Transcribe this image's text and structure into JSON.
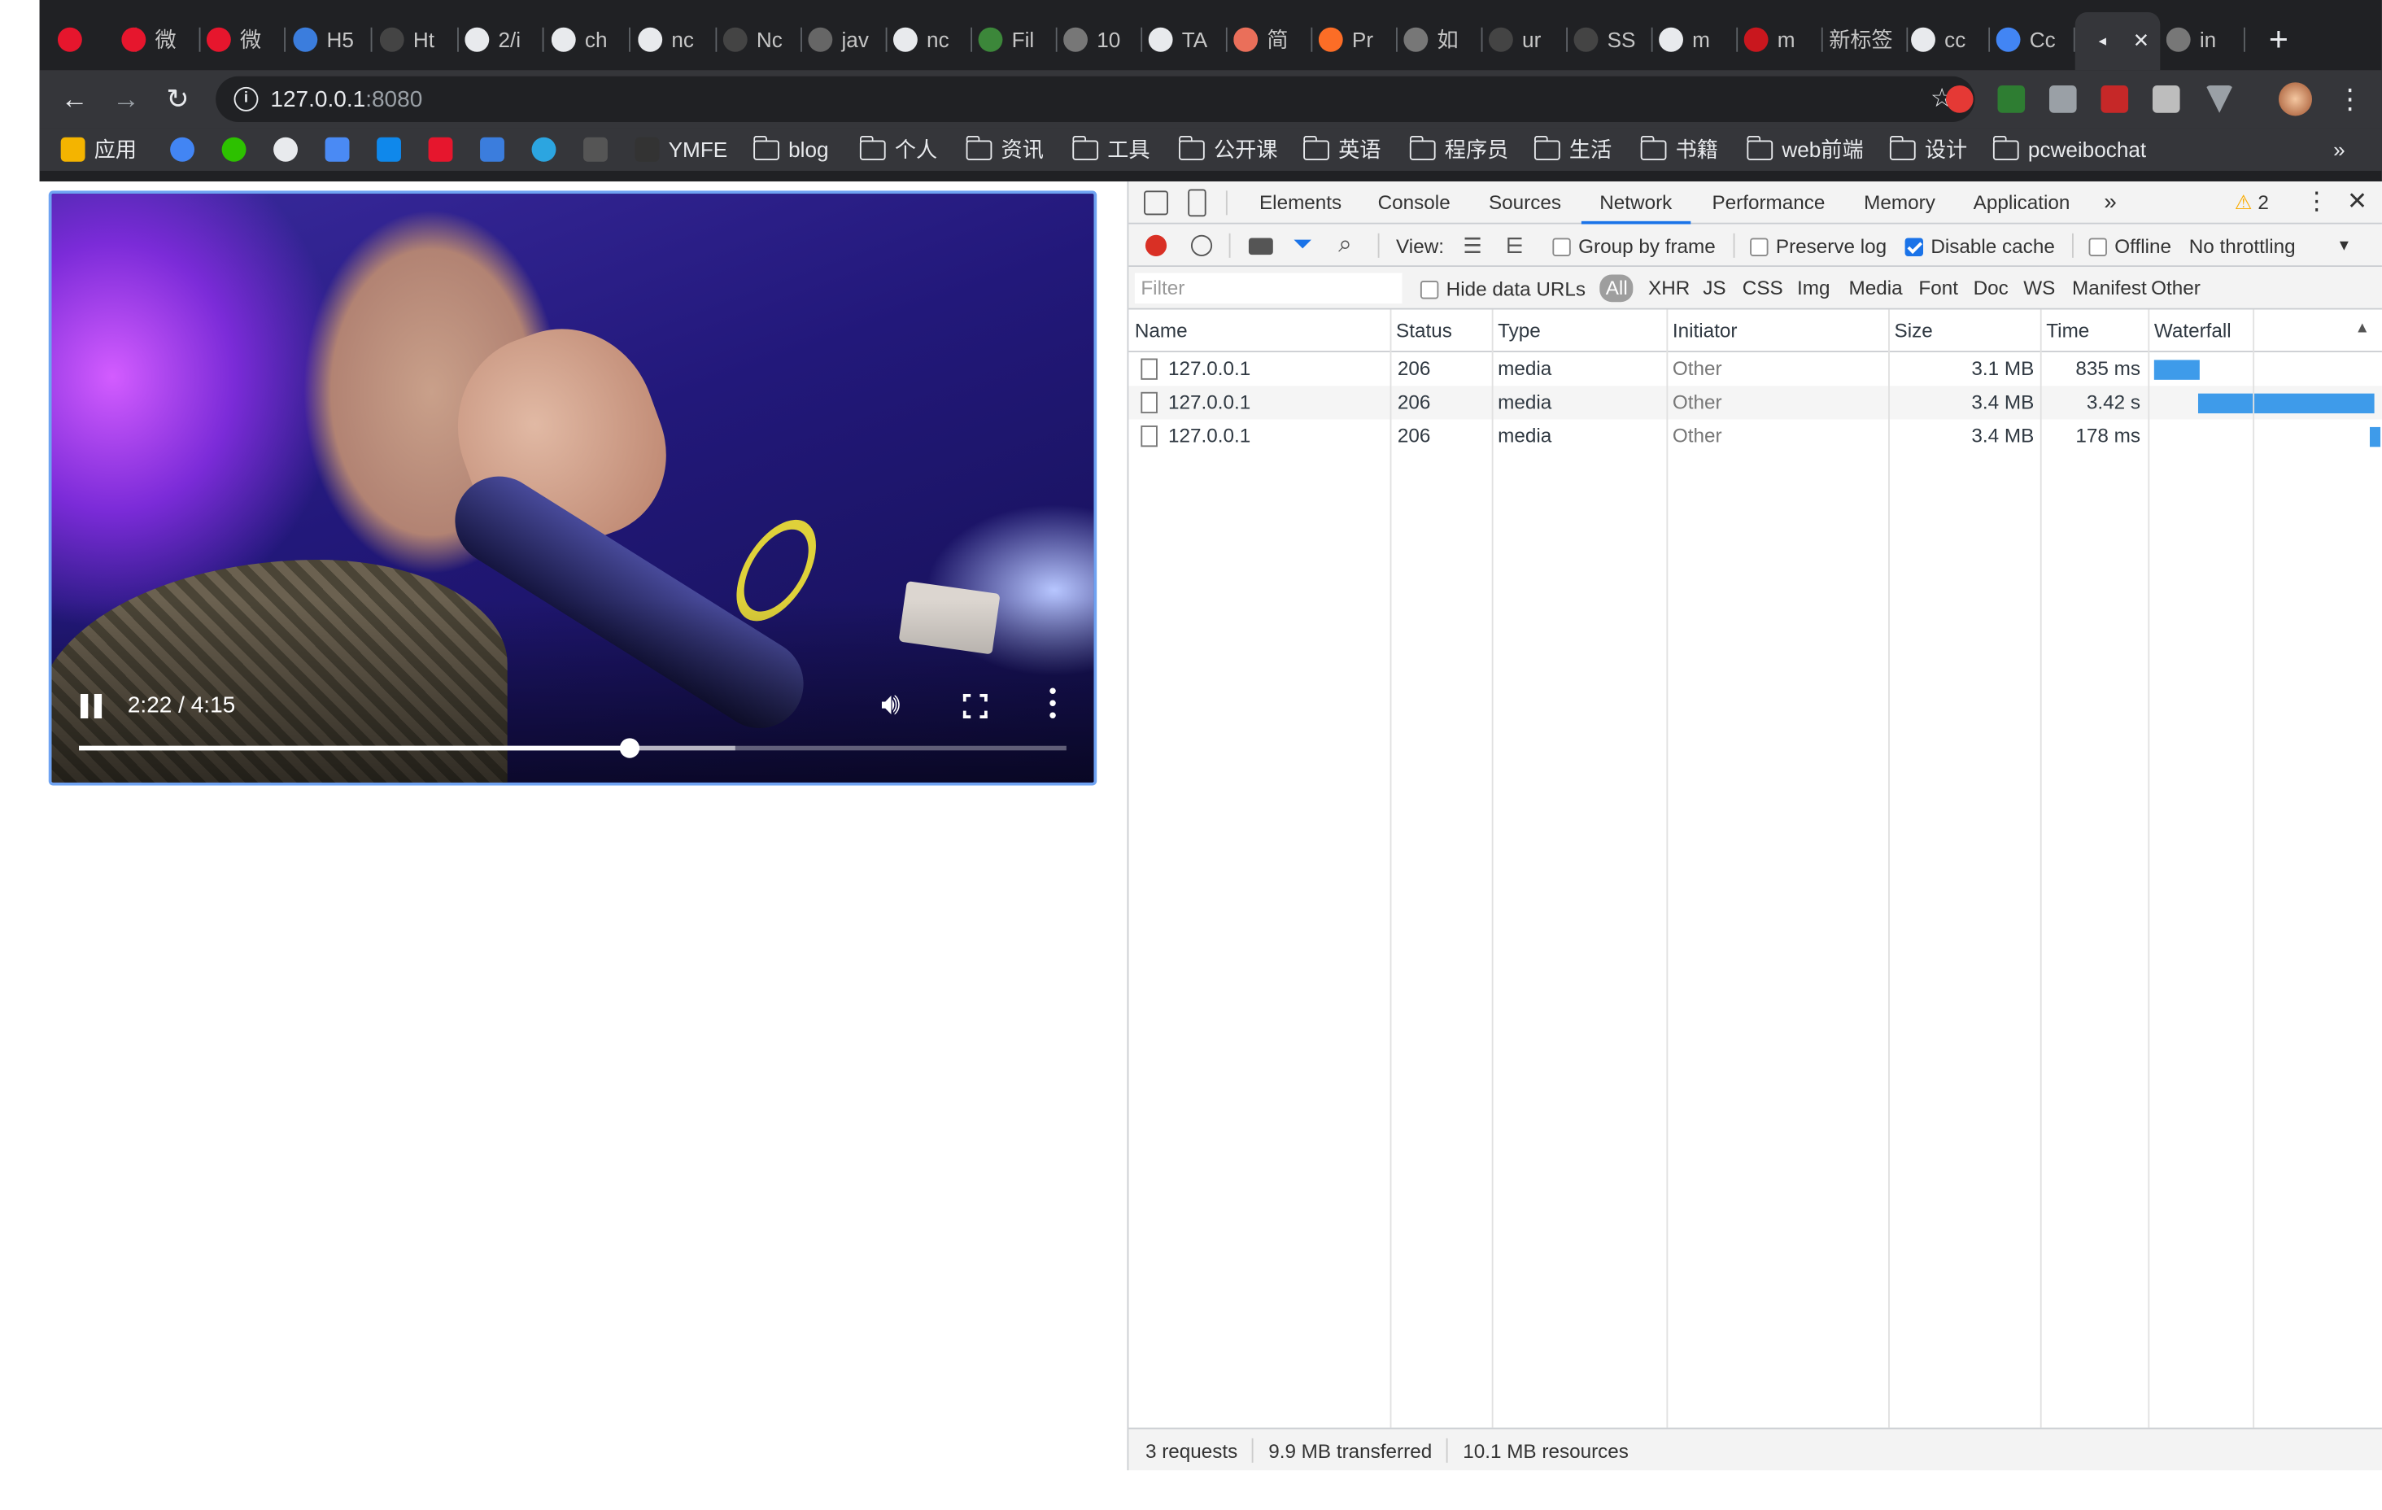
{
  "tabs": [
    {
      "label": "",
      "icon": "weibo-icon",
      "color": "#e6162d"
    },
    {
      "label": "微",
      "icon": "weibo-icon",
      "color": "#e6162d"
    },
    {
      "label": "微",
      "icon": "weibo-icon",
      "color": "#e6162d"
    },
    {
      "label": "H5",
      "icon": "chevron-logo-icon",
      "color": "#3b7ddd"
    },
    {
      "label": "Ht",
      "icon": "github-icon",
      "color": "#444"
    },
    {
      "label": "2/i",
      "icon": "globe-icon",
      "color": "#e8eaed"
    },
    {
      "label": "ch",
      "icon": "google-icon",
      "color": "#e8eaed"
    },
    {
      "label": "nc",
      "icon": "google-icon",
      "color": "#e8eaed"
    },
    {
      "label": "Nc",
      "icon": "github-icon",
      "color": "#444"
    },
    {
      "label": "jav",
      "icon": "logo-icon",
      "color": "#666"
    },
    {
      "label": "nc",
      "icon": "google-icon",
      "color": "#e8eaed"
    },
    {
      "label": "Fil",
      "icon": "node-icon",
      "color": "#3c873a"
    },
    {
      "label": "10",
      "icon": "globe-icon",
      "color": "#777"
    },
    {
      "label": "TA",
      "icon": "google-icon",
      "color": "#e8eaed"
    },
    {
      "label": "简",
      "icon": "jianshu-icon",
      "color": "#ea6f5a"
    },
    {
      "label": "Pr",
      "icon": "gitlab-icon",
      "color": "#fc6d26"
    },
    {
      "label": "如",
      "icon": "globe-icon",
      "color": "#777"
    },
    {
      "label": "ur",
      "icon": "github-icon",
      "color": "#444"
    },
    {
      "label": "SS",
      "icon": "github-icon",
      "color": "#444"
    },
    {
      "label": "m",
      "icon": "google-icon",
      "color": "#e8eaed"
    },
    {
      "label": "m",
      "icon": "csdn-icon",
      "color": "#c9171e"
    },
    {
      "label": "新标签",
      "icon": "",
      "color": ""
    },
    {
      "label": "cc",
      "icon": "google-icon",
      "color": "#e8eaed"
    },
    {
      "label": "Cc",
      "icon": "chrome-icon",
      "color": "#4285f4"
    },
    {
      "label": "",
      "icon": "speaker-icon",
      "color": "#e8eaed",
      "active": true
    },
    {
      "label": "in",
      "icon": "globe-icon",
      "color": "#777"
    }
  ],
  "toolbar": {
    "url_host": "127.0.0.1",
    "url_port": ":8080"
  },
  "bookmarks": [
    {
      "label": "应用",
      "icon": "apps-grid-icon"
    },
    {
      "label": "",
      "icon": "chrome-icon"
    },
    {
      "label": "",
      "icon": "wechat-icon"
    },
    {
      "label": "",
      "icon": "google-icon"
    },
    {
      "label": "",
      "icon": "translate-icon"
    },
    {
      "label": "",
      "icon": "zhihu-icon"
    },
    {
      "label": "",
      "icon": "weibo-icon"
    },
    {
      "label": "",
      "icon": "chevron-logo-icon"
    },
    {
      "label": "",
      "icon": "telegram-icon"
    },
    {
      "label": "",
      "icon": "github-icon"
    },
    {
      "label": "YMFE",
      "icon": "y-logo-icon"
    },
    {
      "label": "blog",
      "icon": "folder-icon"
    },
    {
      "label": "个人",
      "icon": "folder-icon"
    },
    {
      "label": "资讯",
      "icon": "folder-icon"
    },
    {
      "label": "工具",
      "icon": "folder-icon"
    },
    {
      "label": "公开课",
      "icon": "folder-icon"
    },
    {
      "label": "英语",
      "icon": "folder-icon"
    },
    {
      "label": "程序员",
      "icon": "folder-icon"
    },
    {
      "label": "生活",
      "icon": "folder-icon"
    },
    {
      "label": "书籍",
      "icon": "folder-icon"
    },
    {
      "label": "web前端",
      "icon": "folder-icon"
    },
    {
      "label": "设计",
      "icon": "folder-icon"
    },
    {
      "label": "pcweibochat",
      "icon": "folder-icon"
    }
  ],
  "bookmarks_overflow": "»",
  "video": {
    "time": "2:22 / 4:15",
    "played_fraction": 0.557,
    "buffered_fraction": 0.665
  },
  "devtools": {
    "tabs": [
      "Elements",
      "Console",
      "Sources",
      "Network",
      "Performance",
      "Memory",
      "Application"
    ],
    "active_tab": "Network",
    "more_tabs": "»",
    "warnings": "2",
    "view_label": "View:",
    "group_by_frame": "Group by frame",
    "preserve_log": "Preserve log",
    "disable_cache": "Disable cache",
    "offline": "Offline",
    "throttling": "No throttling",
    "filter_placeholder": "Filter",
    "hide_data_urls": "Hide data URLs",
    "filter_types": [
      "All",
      "XHR",
      "JS",
      "CSS",
      "Img",
      "Media",
      "Font",
      "Doc",
      "WS",
      "Manifest",
      "Other"
    ],
    "columns": [
      "Name",
      "Status",
      "Type",
      "Initiator",
      "Size",
      "Time",
      "Waterfall"
    ],
    "rows": [
      {
        "name": "127.0.0.1",
        "status": "206",
        "type": "media",
        "initiator": "Other",
        "size": "3.1 MB",
        "time": "835 ms"
      },
      {
        "name": "127.0.0.1",
        "status": "206",
        "type": "media",
        "initiator": "Other",
        "size": "3.4 MB",
        "time": "3.42 s"
      },
      {
        "name": "127.0.0.1",
        "status": "206",
        "type": "media",
        "initiator": "Other",
        "size": "3.4 MB",
        "time": "178 ms"
      }
    ],
    "waterfall": [
      {
        "start": 0.0,
        "duration": 0.21
      },
      {
        "start": 0.2,
        "duration": 0.8
      },
      {
        "start": 0.98,
        "duration": 0.05
      }
    ],
    "status": {
      "requests": "3 requests",
      "transferred": "9.9 MB transferred",
      "resources": "10.1 MB resources"
    },
    "colors": {
      "accent": "#1a73e8",
      "waterfall": "#3e9bea",
      "record": "#d93025"
    }
  }
}
